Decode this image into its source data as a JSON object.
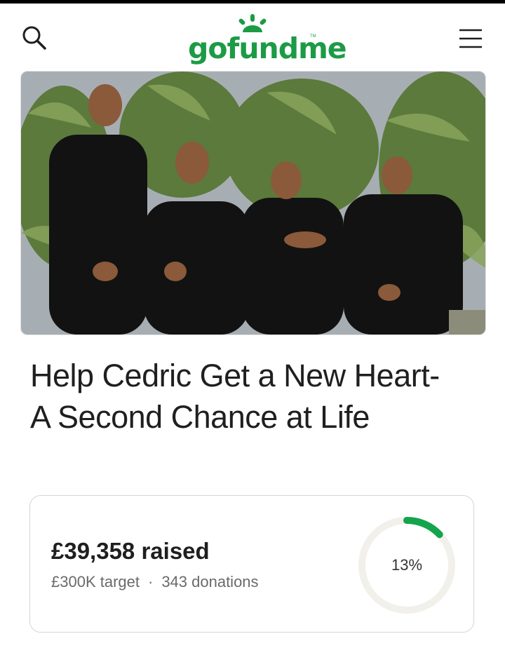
{
  "header": {
    "logo_text": "gofundme",
    "logo_tm": "TM",
    "search_icon": "search-icon",
    "menu_icon": "hamburger-menu-icon",
    "brand_color": "#1c9b45"
  },
  "campaign": {
    "title": "Help Cedric Get a New Heart- A Second Chance at Life",
    "raised": "£39,358 raised",
    "target": "£300K target",
    "separator": "·",
    "donations": "343 donations",
    "progress_label": "13%",
    "progress_fraction": 0.13,
    "progress_color": "#14a44d"
  }
}
